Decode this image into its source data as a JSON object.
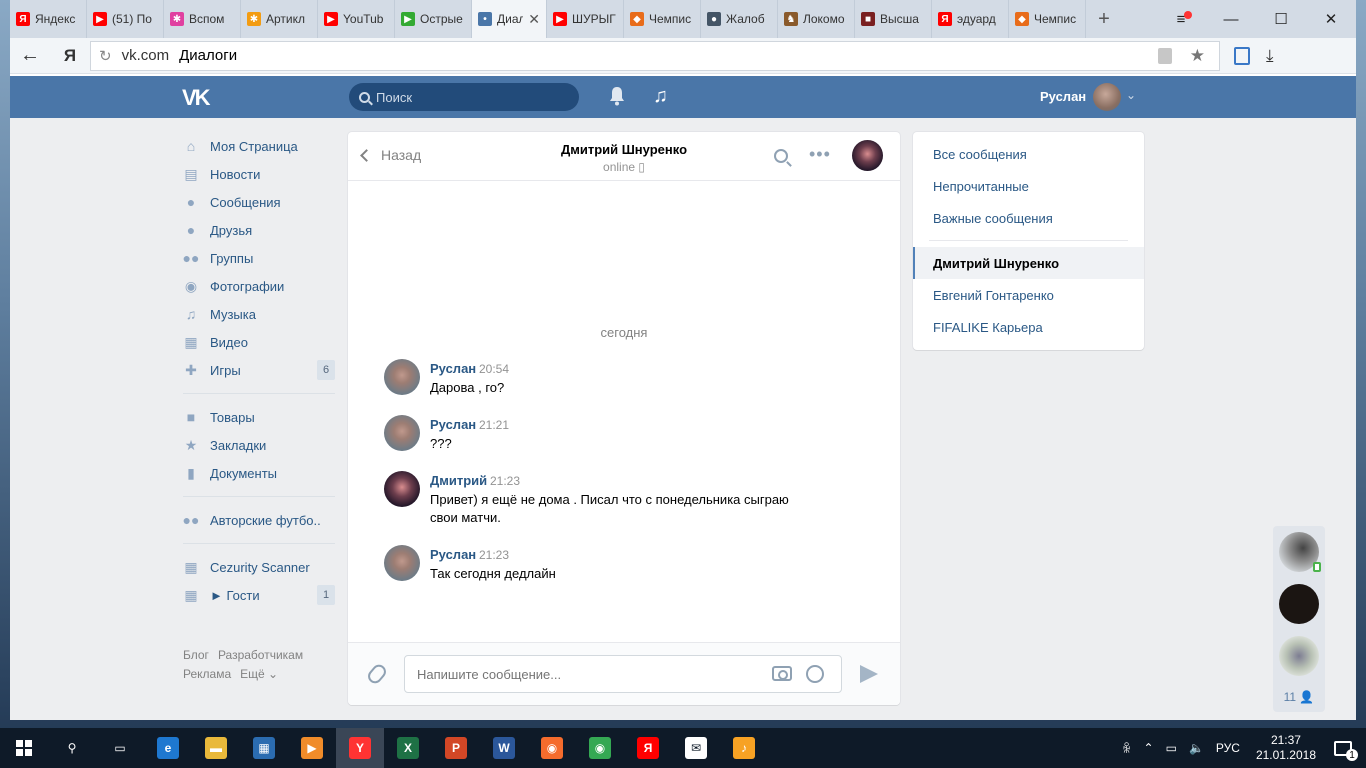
{
  "browser": {
    "tabs": [
      {
        "label": "Яндекс",
        "icon": "yandex-icon",
        "color": "#ff0000",
        "glyph": "Я"
      },
      {
        "label": "(51) По",
        "icon": "youtube-icon",
        "color": "#ff0000",
        "glyph": "▶"
      },
      {
        "label": "Вспом",
        "icon": "pinwheel-icon",
        "color": "#e040a0",
        "glyph": "✱"
      },
      {
        "label": "Артикл",
        "icon": "pinwheel-icon",
        "color": "#f39c12",
        "glyph": "✱"
      },
      {
        "label": "YouTub",
        "icon": "youtube-icon",
        "color": "#ff0000",
        "glyph": "▶"
      },
      {
        "label": "Острые",
        "icon": "play-icon",
        "color": "#33aa33",
        "glyph": "▶"
      },
      {
        "label": "Диал",
        "icon": "vk-chat-icon",
        "color": "#4a76a8",
        "glyph": "•",
        "active": true
      },
      {
        "label": "ШУРЫГ",
        "icon": "youtube-icon",
        "color": "#ff0000",
        "glyph": "▶"
      },
      {
        "label": "Чемпис",
        "icon": "shield-icon",
        "color": "#e86c1a",
        "glyph": "◆"
      },
      {
        "label": "Жалоб",
        "icon": "globe-icon",
        "color": "#445566",
        "glyph": "●"
      },
      {
        "label": "Локомо",
        "icon": "train-icon",
        "color": "#8a5a2b",
        "glyph": "♞"
      },
      {
        "label": "Высша",
        "icon": "photo-icon",
        "color": "#7a2020",
        "glyph": "■"
      },
      {
        "label": "эдуард",
        "icon": "yandex-icon",
        "color": "#ff0000",
        "glyph": "Я"
      },
      {
        "label": "Чемпис",
        "icon": "shield-icon",
        "color": "#e86c1a",
        "glyph": "◆"
      }
    ],
    "new_tab": "+",
    "url_domain": "vk.com",
    "url_title": "Диалоги",
    "yandex_btn": "Я"
  },
  "vk_header": {
    "search_placeholder": "Поиск",
    "user_name": "Руслан"
  },
  "left_nav": [
    {
      "label": "Моя Страница",
      "icon": "home-icon",
      "glyph": "⌂"
    },
    {
      "label": "Новости",
      "icon": "news-icon",
      "glyph": "▤"
    },
    {
      "label": "Сообщения",
      "icon": "messages-icon",
      "glyph": "●"
    },
    {
      "label": "Друзья",
      "icon": "friend-icon",
      "glyph": "●"
    },
    {
      "label": "Группы",
      "icon": "groups-icon",
      "glyph": "●●"
    },
    {
      "label": "Фотографии",
      "icon": "camera-icon",
      "glyph": "◉"
    },
    {
      "label": "Музыка",
      "icon": "music-icon",
      "glyph": "♫"
    },
    {
      "label": "Видео",
      "icon": "video-icon",
      "glyph": "▦"
    },
    {
      "label": "Игры",
      "icon": "gamepad-icon",
      "glyph": "✚",
      "count": "6"
    }
  ],
  "left_nav2": [
    {
      "label": "Товары",
      "icon": "bag-icon",
      "glyph": "■"
    },
    {
      "label": "Закладки",
      "icon": "star-icon",
      "glyph": "★"
    },
    {
      "label": "Документы",
      "icon": "document-icon",
      "glyph": "▮"
    }
  ],
  "left_nav3": [
    {
      "label": "Авторские футбо..",
      "icon": "groups-icon",
      "glyph": "●●"
    }
  ],
  "left_nav4": [
    {
      "label": "Cezurity Scanner",
      "icon": "apps-icon",
      "glyph": "▦"
    },
    {
      "label": "► Гости",
      "icon": "apps-icon",
      "glyph": "▦",
      "count": "1"
    }
  ],
  "footer": {
    "links": [
      "Блог",
      "Разработчикам",
      "Реклама",
      "Ещё ⌄"
    ]
  },
  "chat": {
    "back_label": "Назад",
    "peer_name": "Дмитрий Шнуренко",
    "peer_status": "online ▯",
    "day_label": "сегодня",
    "messages": [
      {
        "author": "Руслан",
        "time": "20:54",
        "text": "Дарова , го?",
        "ava": "r"
      },
      {
        "author": "Руслан",
        "time": "21:21",
        "text": "???",
        "ava": "r"
      },
      {
        "author": "Дмитрий",
        "time": "21:23",
        "text": "Привет) я ещё не дома . Писал что с понедельника сыграю свои матчи.",
        "ava": "d"
      },
      {
        "author": "Руслан",
        "time": "21:23",
        "text": "Так сегодня дедлайн",
        "ava": "r"
      }
    ],
    "input_placeholder": "Напишите сообщение..."
  },
  "right_menu": {
    "filters": [
      "Все сообщения",
      "Непрочитанные",
      "Важные сообщения"
    ],
    "dialogs": [
      {
        "label": "Дмитрий Шнуренко",
        "active": true
      },
      {
        "label": "Евгений Гонтаренко",
        "active": false
      },
      {
        "label": "FIFALIKE Карьера",
        "active": false
      }
    ]
  },
  "friends_dock": {
    "count": "11 👤"
  },
  "taskbar": {
    "lang": "РУС",
    "time": "21:37",
    "date": "21.01.2018",
    "notif_count": "1",
    "apps": [
      {
        "icon": "search-icon",
        "glyph": "⚲",
        "color": "transparent"
      },
      {
        "icon": "task-view-icon",
        "glyph": "▭",
        "color": "transparent"
      },
      {
        "icon": "edge-icon",
        "glyph": "e",
        "color": "#1e78d0"
      },
      {
        "icon": "explorer-icon",
        "glyph": "▬",
        "color": "#e9b93b"
      },
      {
        "icon": "store-icon",
        "glyph": "▦",
        "color": "#2b6cb0"
      },
      {
        "icon": "media-icon",
        "glyph": "▶",
        "color": "#f08c2a"
      },
      {
        "icon": "yandex-browser-icon",
        "glyph": "Y",
        "color": "#ff3333",
        "active": true
      },
      {
        "icon": "excel-icon",
        "glyph": "X",
        "color": "#1e7145"
      },
      {
        "icon": "powerpoint-icon",
        "glyph": "P",
        "color": "#d24726"
      },
      {
        "icon": "word-icon",
        "glyph": "W",
        "color": "#2b579a"
      },
      {
        "icon": "origin-icon",
        "glyph": "◉",
        "color": "#f56c2d"
      },
      {
        "icon": "chrome-icon",
        "glyph": "◉",
        "color": "#34a853"
      },
      {
        "icon": "yandex-icon",
        "glyph": "Я",
        "color": "#ff0000"
      },
      {
        "icon": "mail-icon",
        "glyph": "✉",
        "color": "#ffffff"
      },
      {
        "icon": "fl-studio-icon",
        "glyph": "♪",
        "color": "#f7a224"
      }
    ]
  }
}
